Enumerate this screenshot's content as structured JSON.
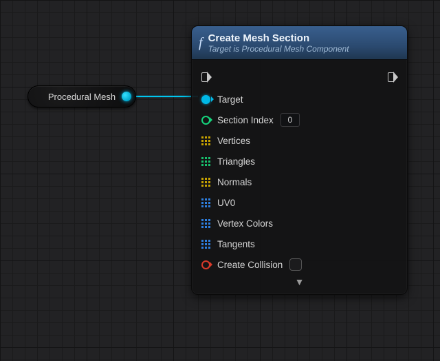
{
  "source_node": {
    "label": "Procedural Mesh"
  },
  "fn": {
    "icon": "f",
    "title": "Create Mesh Section",
    "subtitle": "Target is Procedural Mesh Component",
    "pins": {
      "target": "Target",
      "section_index": {
        "label": "Section Index",
        "value": "0"
      },
      "vertices": "Vertices",
      "triangles": "Triangles",
      "normals": "Normals",
      "uv0": "UV0",
      "vertex_colors": "Vertex Colors",
      "tangents": "Tangents",
      "create_collision": {
        "label": "Create Collision",
        "checked": false
      }
    }
  }
}
